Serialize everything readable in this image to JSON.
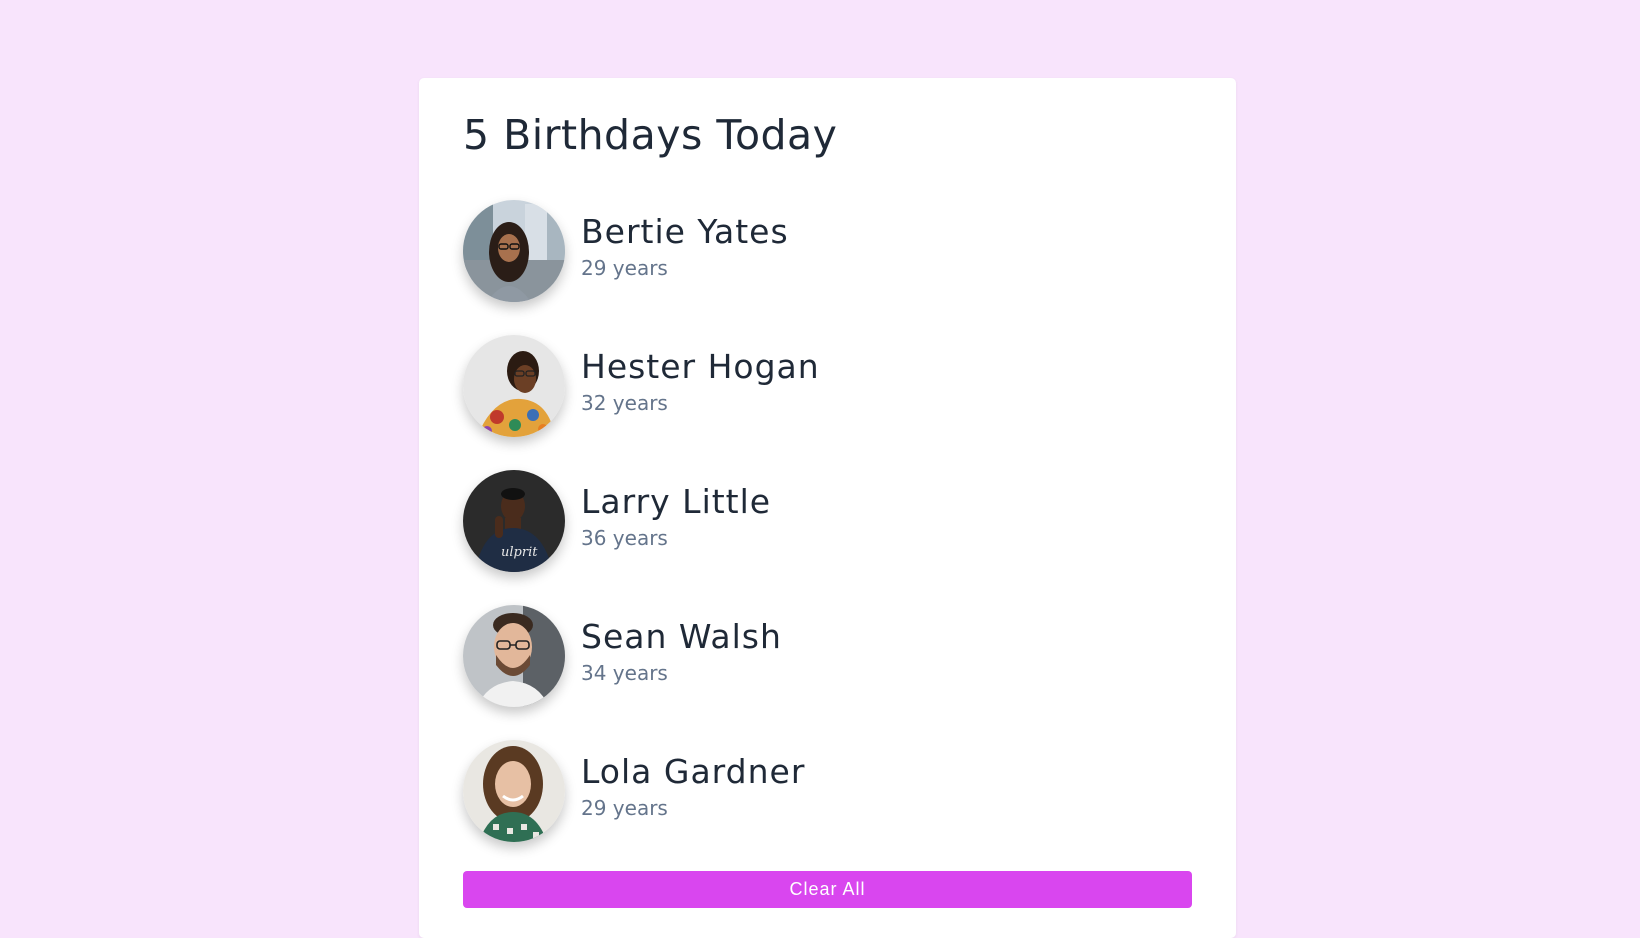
{
  "header": {
    "title": "5 Birthdays Today"
  },
  "people": [
    {
      "name": "Bertie Yates",
      "age": "29 years"
    },
    {
      "name": "Hester Hogan",
      "age": "32 years"
    },
    {
      "name": "Larry Little",
      "age": "36 years"
    },
    {
      "name": "Sean Walsh",
      "age": "34 years"
    },
    {
      "name": "Lola Gardner",
      "age": "29 years"
    }
  ],
  "actions": {
    "clear_label": "Clear All"
  },
  "colors": {
    "page_background": "#f8e4fc",
    "card_background": "#ffffff",
    "accent": "#d946ef",
    "name_text": "#1f2937",
    "age_text": "#64748b"
  }
}
